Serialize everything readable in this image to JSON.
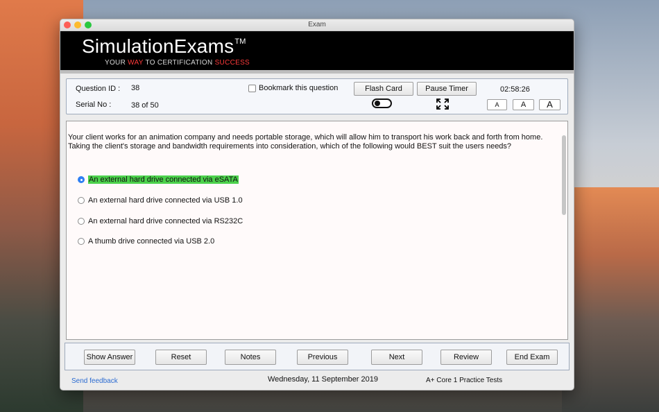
{
  "window": {
    "title": "Exam"
  },
  "banner": {
    "brand": "SimulationExams",
    "trademark": "TM",
    "tagline_part1": "YOUR ",
    "tagline_way": "WAY",
    "tagline_part2": " TO CERTIFICATION ",
    "tagline_success": "SUCCESS",
    "accent_color": "#ff3a3a"
  },
  "info": {
    "question_id_label": "Question ID :",
    "question_id_value": "38",
    "serial_label": "Serial No :",
    "serial_value": "38 of 50",
    "bookmark_label": "Bookmark this question",
    "bookmark_checked": false,
    "flash_card_label": "Flash Card",
    "pause_timer_label": "Pause Timer",
    "timer": "02:58:26",
    "toggle_on": false,
    "fullscreen_icon": "expand-arrows-icon",
    "font_small": "A",
    "font_medium": "A",
    "font_large": "A"
  },
  "question": {
    "text": "Your client works for an animation company and needs portable storage, which will allow him to transport his work back and forth from home. Taking the client's storage and bandwidth requirements into consideration, which of the following would BEST suit the users needs?",
    "options": [
      {
        "label": "An external hard drive connected via eSATA",
        "selected": true,
        "highlight": "#4cd14c"
      },
      {
        "label": "An external hard drive connected via USB 1.0",
        "selected": false
      },
      {
        "label": "An external hard drive connected via RS232C",
        "selected": false
      },
      {
        "label": "A thumb drive connected via USB 2.0",
        "selected": false
      }
    ]
  },
  "nav": {
    "show_answer": "Show Answer",
    "reset": "Reset",
    "notes": "Notes",
    "previous": "Previous",
    "next": "Next",
    "review": "Review",
    "end_exam": "End Exam"
  },
  "footer": {
    "feedback": "Send feedback",
    "date": "Wednesday, 11 September 2019",
    "product": "A+ Core 1 Practice Tests"
  }
}
